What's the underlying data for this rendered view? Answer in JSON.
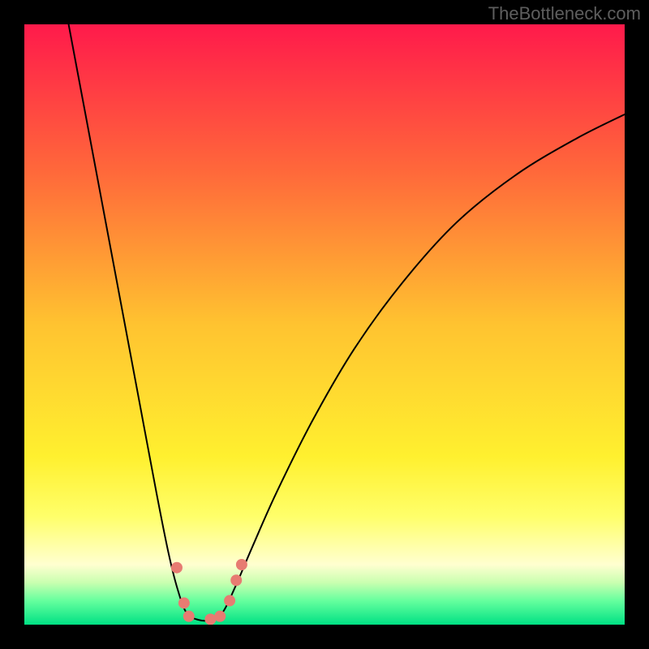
{
  "watermark": "TheBottleneck.com",
  "chart_data": {
    "type": "line",
    "title": "",
    "xlabel": "",
    "ylabel": "",
    "xlim": [
      0,
      100
    ],
    "ylim": [
      0,
      100
    ],
    "background_gradient": {
      "stops": [
        {
          "offset": 0.0,
          "color": "#ff1a4b"
        },
        {
          "offset": 0.25,
          "color": "#ff6a3a"
        },
        {
          "offset": 0.5,
          "color": "#ffc330"
        },
        {
          "offset": 0.72,
          "color": "#fff02f"
        },
        {
          "offset": 0.82,
          "color": "#ffff6a"
        },
        {
          "offset": 0.9,
          "color": "#ffffd0"
        },
        {
          "offset": 0.93,
          "color": "#c9ffb0"
        },
        {
          "offset": 0.96,
          "color": "#66ff9e"
        },
        {
          "offset": 1.0,
          "color": "#00e184"
        }
      ]
    },
    "series": [
      {
        "name": "bottleneck-curve",
        "stroke": "#000000",
        "stroke_width": 2,
        "points": [
          {
            "x": 7.0,
            "y": 102.0
          },
          {
            "x": 10.0,
            "y": 86.0
          },
          {
            "x": 13.0,
            "y": 70.0
          },
          {
            "x": 16.0,
            "y": 54.0
          },
          {
            "x": 19.0,
            "y": 38.0
          },
          {
            "x": 22.0,
            "y": 22.0
          },
          {
            "x": 24.0,
            "y": 12.0
          },
          {
            "x": 25.5,
            "y": 6.0
          },
          {
            "x": 27.0,
            "y": 2.0
          },
          {
            "x": 29.0,
            "y": 0.8
          },
          {
            "x": 31.0,
            "y": 0.8
          },
          {
            "x": 33.0,
            "y": 2.0
          },
          {
            "x": 35.0,
            "y": 6.0
          },
          {
            "x": 38.0,
            "y": 13.0
          },
          {
            "x": 42.0,
            "y": 22.0
          },
          {
            "x": 48.0,
            "y": 34.0
          },
          {
            "x": 55.0,
            "y": 46.0
          },
          {
            "x": 63.0,
            "y": 57.0
          },
          {
            "x": 72.0,
            "y": 67.0
          },
          {
            "x": 82.0,
            "y": 75.0
          },
          {
            "x": 92.0,
            "y": 81.0
          },
          {
            "x": 100.0,
            "y": 85.0
          }
        ]
      }
    ],
    "markers": {
      "fill": "#e77b72",
      "radius": 7,
      "points": [
        {
          "x": 25.4,
          "y": 9.5
        },
        {
          "x": 26.6,
          "y": 3.6
        },
        {
          "x": 27.4,
          "y": 1.4
        },
        {
          "x": 31.0,
          "y": 0.9
        },
        {
          "x": 32.6,
          "y": 1.4
        },
        {
          "x": 34.2,
          "y": 4.0
        },
        {
          "x": 35.3,
          "y": 7.4
        },
        {
          "x": 36.2,
          "y": 10.0
        }
      ]
    }
  }
}
